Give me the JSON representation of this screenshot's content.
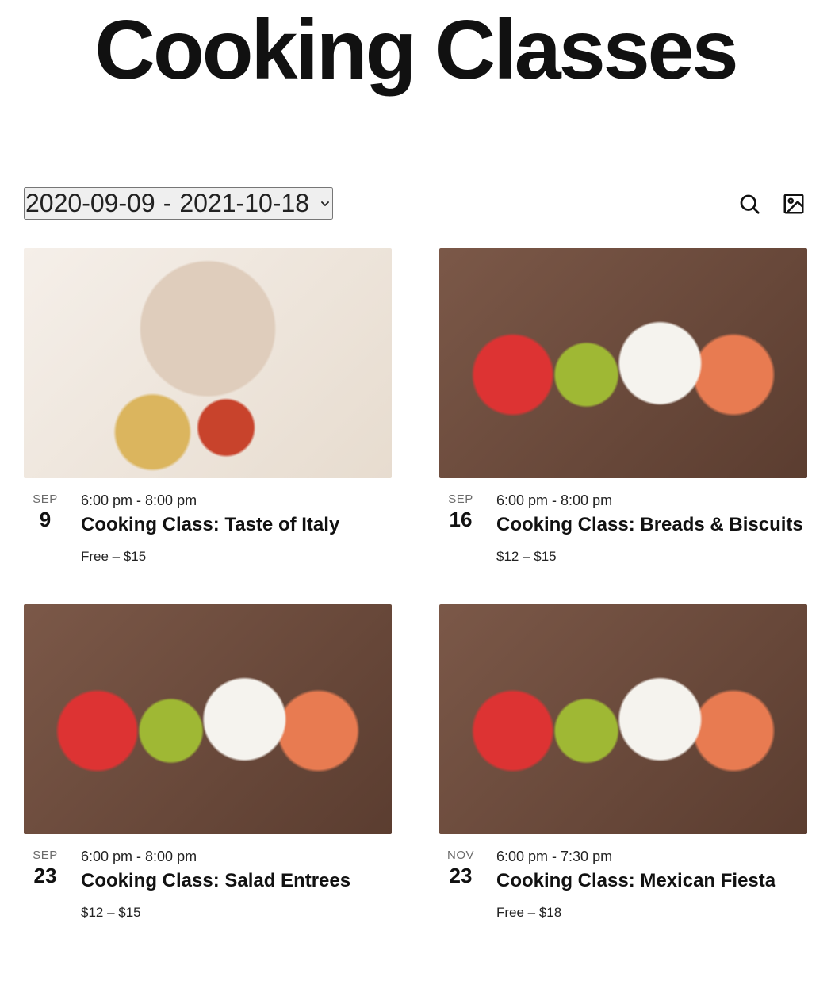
{
  "page_title": "Cooking Classes",
  "filter": {
    "date_range_start": "2020-09-09",
    "date_range_sep": " - ",
    "date_range_end": "2021-10-18"
  },
  "events": [
    {
      "image_class": "placeholder-chef",
      "month": "SEP",
      "day": "9",
      "time": "6:00 pm - 8:00 pm",
      "title": "Cooking Class: Taste of Italy",
      "price": "Free – $15"
    },
    {
      "image_class": "placeholder-group",
      "month": "SEP",
      "day": "16",
      "time": "6:00 pm - 8:00 pm",
      "title": "Cooking Class: Breads & Biscuits",
      "price": "$12 – $15"
    },
    {
      "image_class": "placeholder-group",
      "month": "SEP",
      "day": "23",
      "time": "6:00 pm - 8:00 pm",
      "title": "Cooking Class: Salad Entrees",
      "price": "$12 – $15"
    },
    {
      "image_class": "placeholder-group",
      "month": "NOV",
      "day": "23",
      "time": "6:00 pm - 7:30 pm",
      "title": "Cooking Class: Mexican Fiesta",
      "price": "Free – $18"
    }
  ]
}
